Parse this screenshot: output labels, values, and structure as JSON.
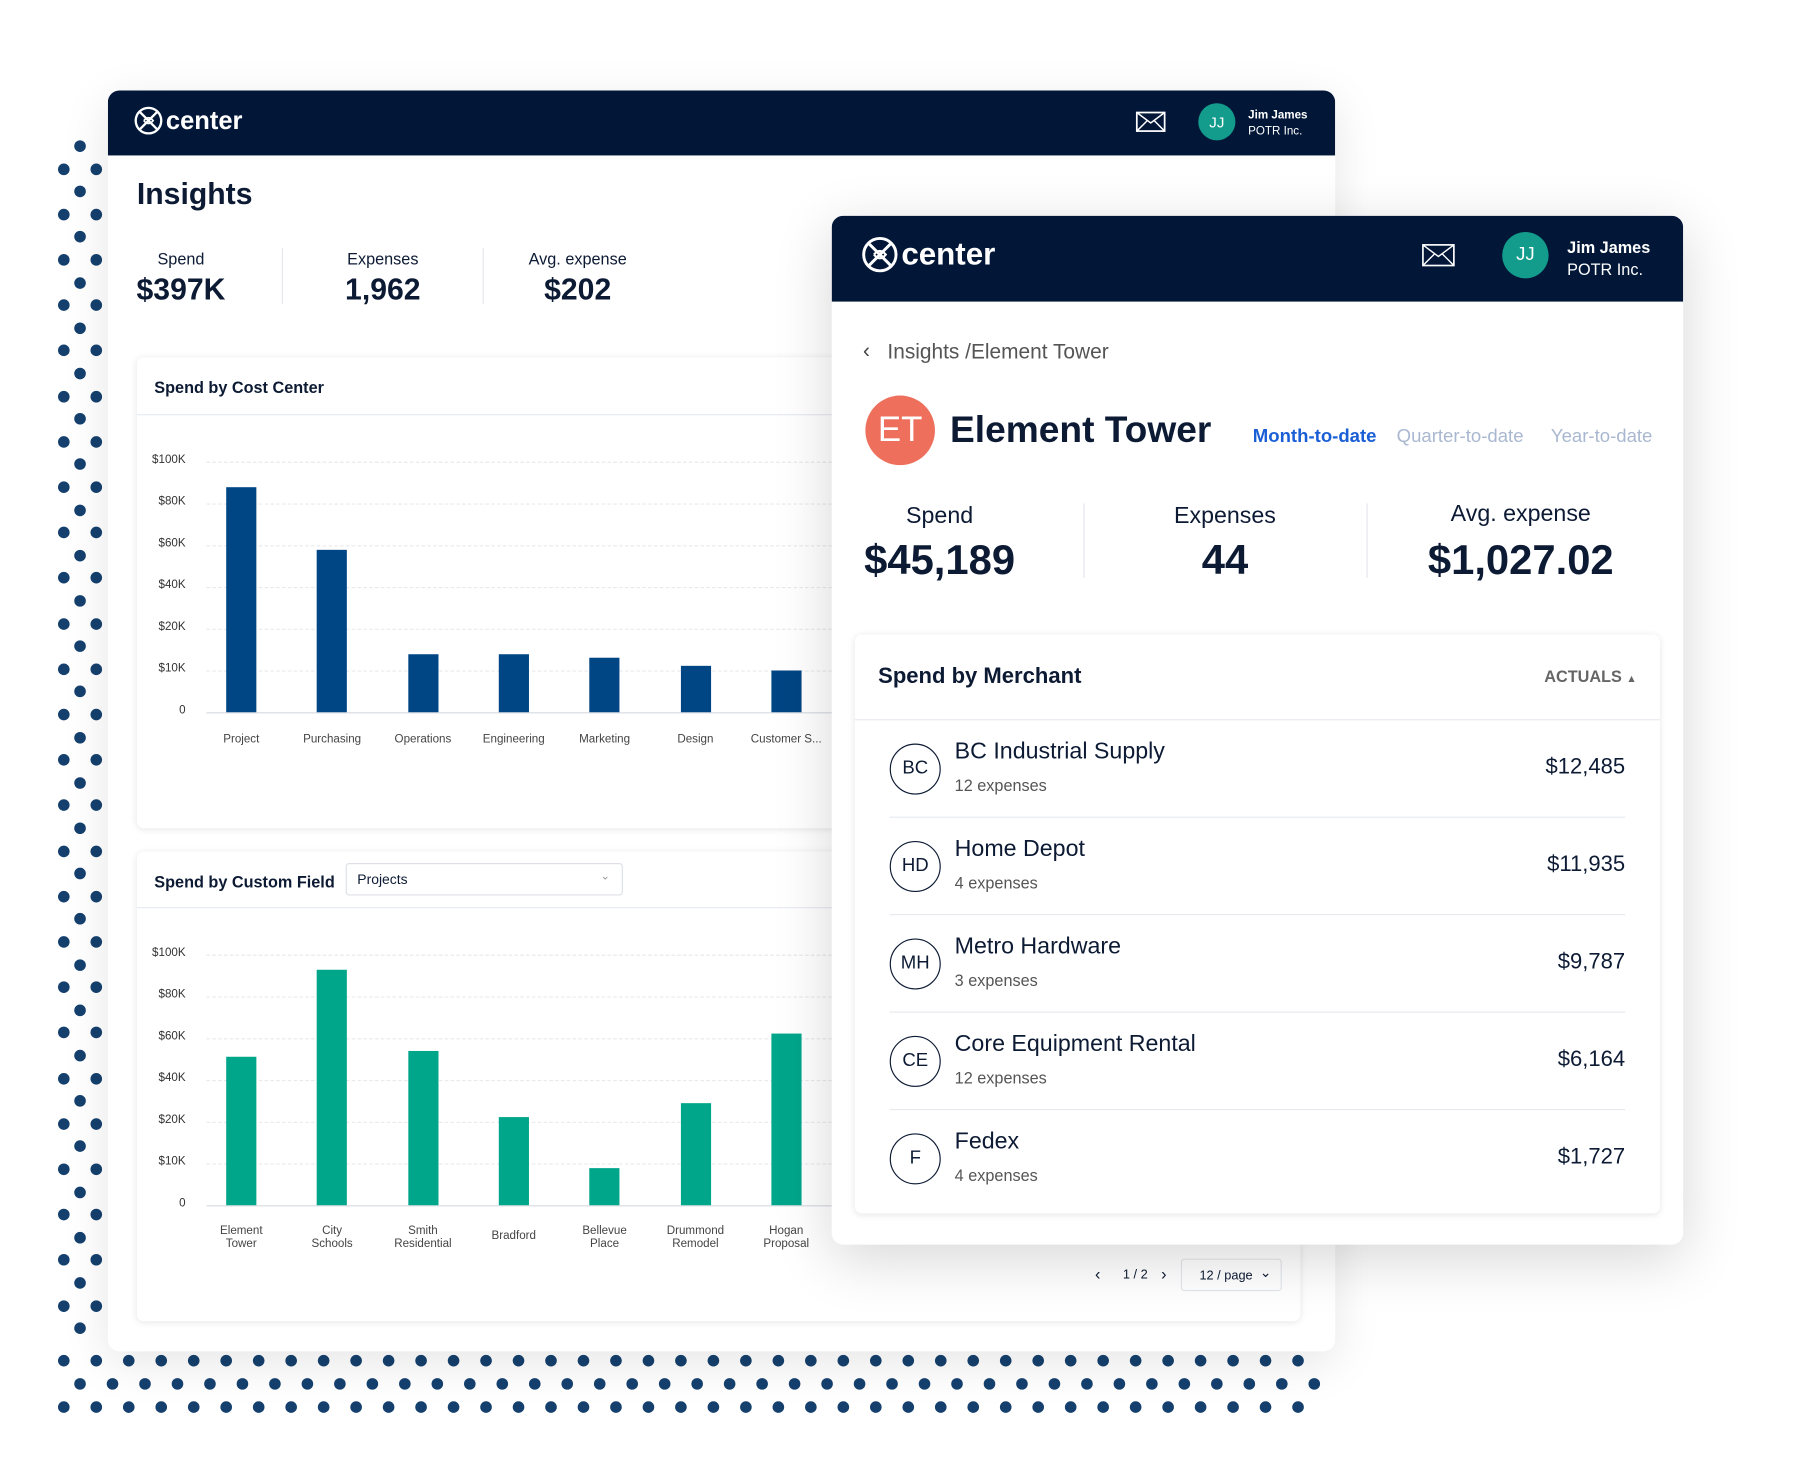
{
  "brand": {
    "name": "center",
    "navy": "#021738",
    "accent": "#1a5fd6"
  },
  "user": {
    "initials": "JJ",
    "name": "Jim James",
    "company": "POTR Inc."
  },
  "insights": {
    "title": "Insights",
    "stats": [
      {
        "label": "Spend",
        "value": "$397K"
      },
      {
        "label": "Expenses",
        "value": "1,962"
      },
      {
        "label": "Avg. expense",
        "value": "$202"
      }
    ],
    "cost_center_title": "Spend by Cost Center",
    "custom_field_title": "Spend by Custom Field",
    "custom_field_select": "Projects",
    "pagination": {
      "page": "1 / 2",
      "page_size": "12 / page"
    }
  },
  "chart_data": [
    {
      "type": "bar",
      "title": "Spend by Cost Center",
      "color": "#004584",
      "ticks": [
        "$100K",
        "$80K",
        "$60K",
        "$40K",
        "$20K",
        "$10K",
        "0"
      ],
      "tick_values": [
        100,
        80,
        60,
        40,
        20,
        10,
        0
      ],
      "categories": [
        "Project",
        "Purchasing",
        "Operations",
        "Engineering",
        "Marketing",
        "Design",
        "Customer S..."
      ],
      "values": [
        88,
        58,
        14,
        14,
        13,
        11,
        10
      ],
      "unit": "$K"
    },
    {
      "type": "bar",
      "title": "Spend by Custom Field",
      "color": "#00a68a",
      "ticks": [
        "$100K",
        "$80K",
        "$60K",
        "$40K",
        "$20K",
        "$10K",
        "0"
      ],
      "tick_values": [
        100,
        80,
        60,
        40,
        20,
        10,
        0
      ],
      "categories": [
        "Element\nTower",
        "City\nSchools",
        "Smith\nResidential",
        "Bradford",
        "Bellevue\nPlace",
        "Drummond\nRemodel",
        "Hogan\nProposal"
      ],
      "values": [
        51,
        93,
        54,
        22,
        9,
        29,
        62
      ],
      "unit": "$K"
    }
  ],
  "detail": {
    "breadcrumb": "Insights /Element Tower",
    "avatar": "ET",
    "avatar_color": "#ee6f5c",
    "title": "Element Tower",
    "tabs": [
      {
        "label": "Month-to-date",
        "active": true
      },
      {
        "label": "Quarter-to-date",
        "active": false
      },
      {
        "label": "Year-to-date",
        "active": false
      }
    ],
    "stats": [
      {
        "label": "Spend",
        "value": "$45,189"
      },
      {
        "label": "Expenses",
        "value": "44"
      },
      {
        "label": "Avg. expense",
        "value": "$1,027.02"
      }
    ],
    "merchant_title": "Spend by Merchant",
    "sort_label": "ACTUALS",
    "merchants": [
      {
        "initials": "BC",
        "name": "BC Industrial Supply",
        "count": "12 expenses",
        "amount": "$12,485"
      },
      {
        "initials": "HD",
        "name": "Home Depot",
        "count": "4 expenses",
        "amount": "$11,935"
      },
      {
        "initials": "MH",
        "name": "Metro Hardware",
        "count": "3 expenses",
        "amount": "$9,787"
      },
      {
        "initials": "CE",
        "name": "Core Equipment Rental",
        "count": "12 expenses",
        "amount": "$6,164"
      },
      {
        "initials": "F",
        "name": "Fedex",
        "count": "4 expenses",
        "amount": "$1,727"
      }
    ]
  }
}
